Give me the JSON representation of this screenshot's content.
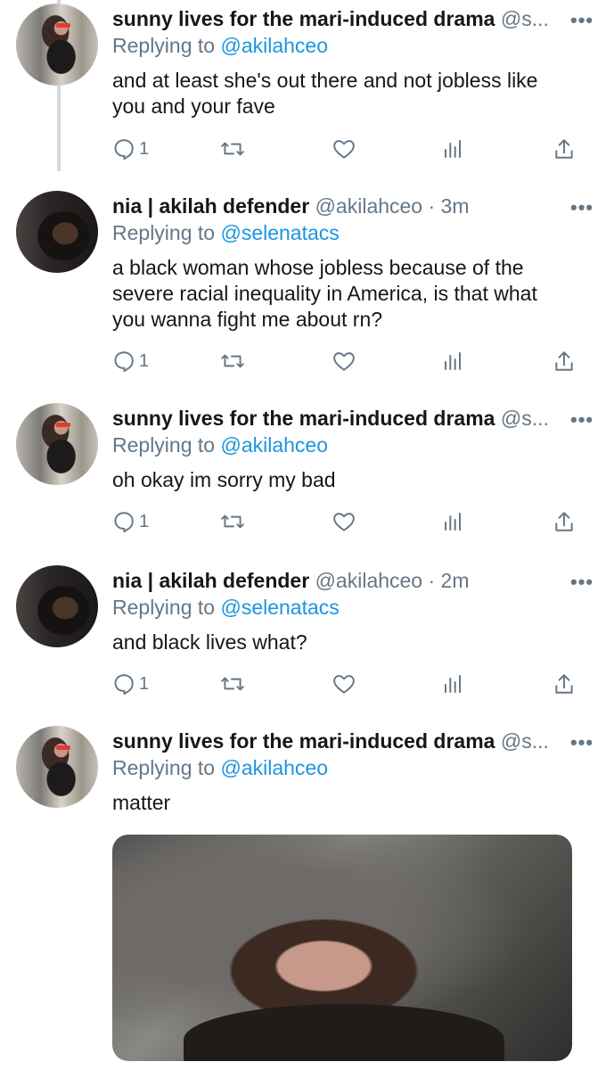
{
  "tweets": [
    {
      "avatar": "sunny-avatar",
      "name": "sunny lives for the mari-induced drama",
      "handle": "@s...",
      "reply_prefix": "Replying to ",
      "reply_to": "@akilahceo",
      "text_lines": [
        "and at least she's out there and not jobless like",
        "you and your fave"
      ],
      "reply_count": "1"
    },
    {
      "avatar": "nia-avatar",
      "name": "nia | akilah defender",
      "handle": "@akilahceo · 3m",
      "reply_prefix": "Replying to ",
      "reply_to": "@selenatacs",
      "text_lines": [
        "a black woman whose jobless because of the",
        "severe racial inequality in America, is that what",
        "you wanna fight me about rn?"
      ],
      "reply_count": "1"
    },
    {
      "avatar": "sunny-avatar",
      "name": "sunny lives for the mari-induced drama",
      "handle": "@s...",
      "reply_prefix": "Replying to ",
      "reply_to": "@akilahceo",
      "text_lines": [
        "oh okay im sorry my bad"
      ],
      "reply_count": "1"
    },
    {
      "avatar": "nia-avatar",
      "name": "nia | akilah defender",
      "handle": "@akilahceo · 2m",
      "reply_prefix": "Replying to ",
      "reply_to": "@selenatacs",
      "text_lines": [
        "and black lives what?"
      ],
      "reply_count": "1"
    },
    {
      "avatar": "sunny-avatar",
      "name": "sunny lives for the mari-induced drama",
      "handle": "@s...",
      "reply_prefix": "Replying to ",
      "reply_to": "@akilahceo",
      "text_lines": [
        "matter"
      ],
      "media": "photo-of-crying-woman"
    }
  ],
  "more_glyph": "•••",
  "icons": [
    "reply-icon",
    "retweet-icon",
    "like-icon",
    "analytics-icon",
    "share-icon",
    "more-icon"
  ],
  "colors": {
    "link": "#1b95e0",
    "secondary": "#657786",
    "text": "#14171a",
    "thread_line": "#cfd9de"
  }
}
